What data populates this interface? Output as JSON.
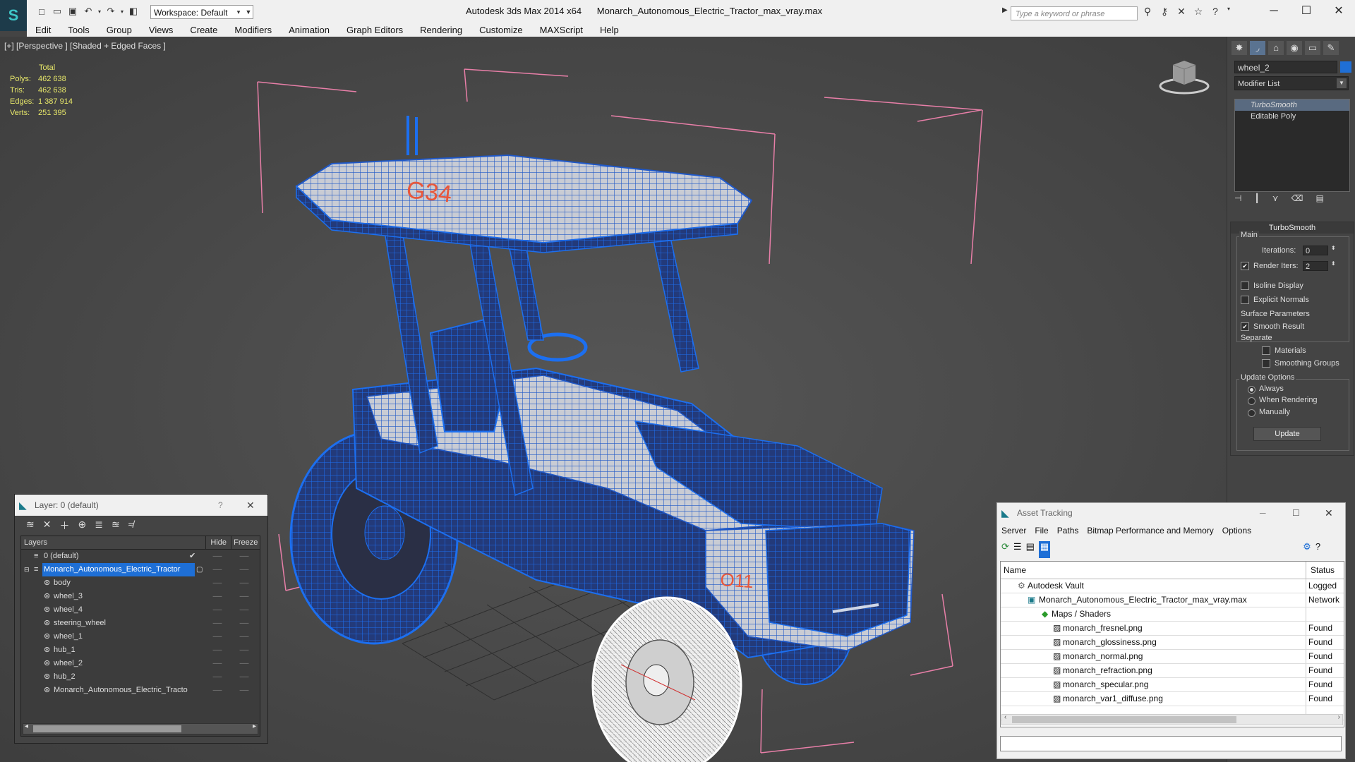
{
  "app": {
    "title_app": "Autodesk 3ds Max  2014 x64",
    "title_file": "Monarch_Autonomous_Electric_Tractor_max_vray.max",
    "workspace_label": "Workspace: Default",
    "search_placeholder": "Type a keyword or phrase"
  },
  "menu": [
    "Edit",
    "Tools",
    "Group",
    "Views",
    "Create",
    "Modifiers",
    "Animation",
    "Graph Editors",
    "Rendering",
    "Customize",
    "MAXScript",
    "Help"
  ],
  "viewport": {
    "label": "[+] [Perspective ] [Shaded + Edged Faces ]",
    "stats_header": "Total",
    "stats": [
      {
        "k": "Polys:",
        "v": "462 638"
      },
      {
        "k": "Tris:",
        "v": "462 638"
      },
      {
        "k": "Edges:",
        "v": "1 387 914"
      },
      {
        "k": "Verts:",
        "v": "251 395"
      }
    ],
    "hood_text": "G34",
    "side_text": "O11"
  },
  "command_panel": {
    "object_name": "wheel_2",
    "object_color": "#1f6fd6",
    "modifier_list_label": "Modifier List",
    "stack": [
      "TurboSmooth",
      "Editable Poly"
    ],
    "rollout_title": "TurboSmooth",
    "main_label": "Main",
    "iterations_label": "Iterations:",
    "iterations_value": "0",
    "render_iters_label": "Render Iters:",
    "render_iters_value": "2",
    "isoline_label": "Isoline Display",
    "explicit_label": "Explicit Normals",
    "surface_label": "Surface Parameters",
    "smooth_label": "Smooth Result",
    "separate_label": "Separate",
    "materials_label": "Materials",
    "smoothing_label": "Smoothing Groups",
    "update_options_label": "Update Options",
    "always_label": "Always",
    "when_rendering_label": "When Rendering",
    "manually_label": "Manually",
    "update_button": "Update"
  },
  "layer_window": {
    "title": "Layer: 0 (default)",
    "help": "?",
    "col_layers": "Layers",
    "col_hide": "Hide",
    "col_freeze": "Freeze",
    "rows": [
      {
        "name": "0 (default)",
        "indent": 0
      },
      {
        "name": "Monarch_Autonomous_Electric_Tractor",
        "indent": 0
      },
      {
        "name": "body",
        "indent": 1
      },
      {
        "name": "wheel_3",
        "indent": 1
      },
      {
        "name": "wheel_4",
        "indent": 1
      },
      {
        "name": "steering_wheel",
        "indent": 1
      },
      {
        "name": "wheel_1",
        "indent": 1
      },
      {
        "name": "hub_1",
        "indent": 1
      },
      {
        "name": "wheel_2",
        "indent": 1
      },
      {
        "name": "hub_2",
        "indent": 1
      },
      {
        "name": "Monarch_Autonomous_Electric_Tracto",
        "indent": 1
      }
    ]
  },
  "asset_window": {
    "title": "Asset Tracking",
    "menu": [
      "Server",
      "File",
      "Paths",
      "Bitmap Performance and Memory",
      "Options"
    ],
    "col_name": "Name",
    "col_status": "Status",
    "rows": [
      {
        "name": "Autodesk Vault",
        "status": "Logged",
        "indent": 1
      },
      {
        "name": "Monarch_Autonomous_Electric_Tractor_max_vray.max",
        "status": "Network",
        "indent": 2
      },
      {
        "name": "Maps / Shaders",
        "status": "",
        "indent": 3
      },
      {
        "name": "monarch_fresnel.png",
        "status": "Found",
        "indent": 4
      },
      {
        "name": "monarch_glossiness.png",
        "status": "Found",
        "indent": 4
      },
      {
        "name": "monarch_normal.png",
        "status": "Found",
        "indent": 4
      },
      {
        "name": "monarch_refraction.png",
        "status": "Found",
        "indent": 4
      },
      {
        "name": "monarch_specular.png",
        "status": "Found",
        "indent": 4
      },
      {
        "name": "monarch_var1_diffuse.png",
        "status": "Found",
        "indent": 4
      }
    ]
  }
}
